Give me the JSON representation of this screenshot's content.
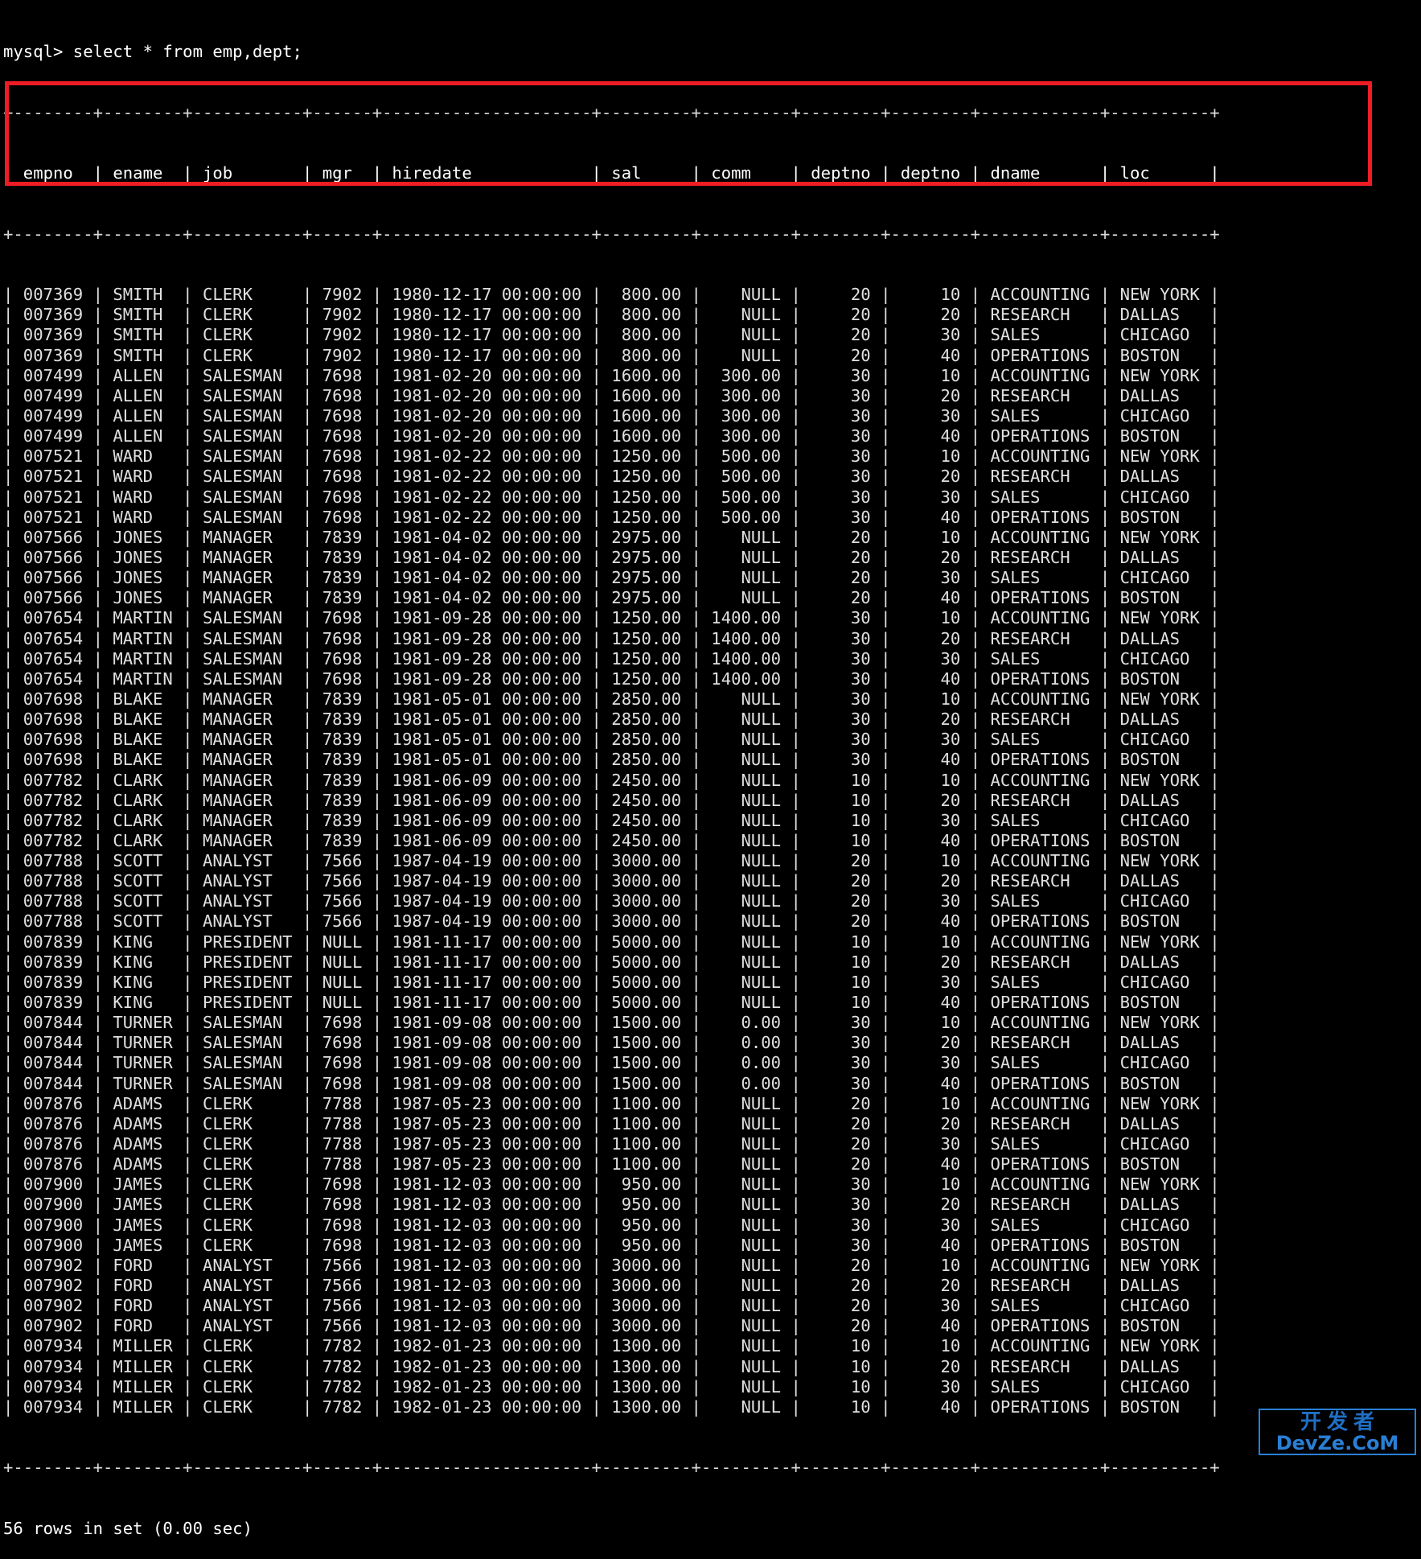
{
  "terminal": {
    "prompt": "mysql> ",
    "query": "select * from emp,dept;",
    "prompt_line": "mysql> select * from emp,dept;",
    "status": "56 rows in set (0.00 sec)",
    "row_count": 56,
    "elapsed": "0.00 sec",
    "background_color": "#000000",
    "text_color": "#e8e8e8"
  },
  "highlight": {
    "color": "#ee1c25",
    "target_rows": 4,
    "target_empno": "007369",
    "target_ename": "SMITH",
    "note": "red box around the four SMITH rows"
  },
  "watermark": {
    "cn": "开发者",
    "en": "DevZe.CoM",
    "color": "#2a7fd4"
  },
  "table": {
    "separator": "+--------+--------+-----------+------+---------------------+---------+---------+--------+--------+------------+----------+",
    "columns": [
      {
        "name": "empno",
        "width": 6,
        "align": "right"
      },
      {
        "name": "ename",
        "width": 6,
        "align": "left"
      },
      {
        "name": "job",
        "width": 9,
        "align": "left"
      },
      {
        "name": "mgr",
        "width": 4,
        "align": "right"
      },
      {
        "name": "hiredate",
        "width": 19,
        "align": "left"
      },
      {
        "name": "sal",
        "width": 7,
        "align": "right"
      },
      {
        "name": "comm",
        "width": 7,
        "align": "right"
      },
      {
        "name": "deptno",
        "width": 6,
        "align": "right"
      },
      {
        "name": "deptno",
        "width": 6,
        "align": "right"
      },
      {
        "name": "dname",
        "width": 10,
        "align": "left"
      },
      {
        "name": "loc",
        "width": 8,
        "align": "left"
      }
    ],
    "headers": [
      "empno",
      "ename",
      "job",
      "mgr",
      "hiredate",
      "sal",
      "comm",
      "deptno",
      "deptno",
      "dname",
      "loc"
    ],
    "rows": [
      [
        "007369",
        "SMITH",
        "CLERK",
        "7902",
        "1980-12-17 00:00:00",
        "800.00",
        "NULL",
        "20",
        "10",
        "ACCOUNTING",
        "NEW YORK"
      ],
      [
        "007369",
        "SMITH",
        "CLERK",
        "7902",
        "1980-12-17 00:00:00",
        "800.00",
        "NULL",
        "20",
        "20",
        "RESEARCH",
        "DALLAS"
      ],
      [
        "007369",
        "SMITH",
        "CLERK",
        "7902",
        "1980-12-17 00:00:00",
        "800.00",
        "NULL",
        "20",
        "30",
        "SALES",
        "CHICAGO"
      ],
      [
        "007369",
        "SMITH",
        "CLERK",
        "7902",
        "1980-12-17 00:00:00",
        "800.00",
        "NULL",
        "20",
        "40",
        "OPERATIONS",
        "BOSTON"
      ],
      [
        "007499",
        "ALLEN",
        "SALESMAN",
        "7698",
        "1981-02-20 00:00:00",
        "1600.00",
        "300.00",
        "30",
        "10",
        "ACCOUNTING",
        "NEW YORK"
      ],
      [
        "007499",
        "ALLEN",
        "SALESMAN",
        "7698",
        "1981-02-20 00:00:00",
        "1600.00",
        "300.00",
        "30",
        "20",
        "RESEARCH",
        "DALLAS"
      ],
      [
        "007499",
        "ALLEN",
        "SALESMAN",
        "7698",
        "1981-02-20 00:00:00",
        "1600.00",
        "300.00",
        "30",
        "30",
        "SALES",
        "CHICAGO"
      ],
      [
        "007499",
        "ALLEN",
        "SALESMAN",
        "7698",
        "1981-02-20 00:00:00",
        "1600.00",
        "300.00",
        "30",
        "40",
        "OPERATIONS",
        "BOSTON"
      ],
      [
        "007521",
        "WARD",
        "SALESMAN",
        "7698",
        "1981-02-22 00:00:00",
        "1250.00",
        "500.00",
        "30",
        "10",
        "ACCOUNTING",
        "NEW YORK"
      ],
      [
        "007521",
        "WARD",
        "SALESMAN",
        "7698",
        "1981-02-22 00:00:00",
        "1250.00",
        "500.00",
        "30",
        "20",
        "RESEARCH",
        "DALLAS"
      ],
      [
        "007521",
        "WARD",
        "SALESMAN",
        "7698",
        "1981-02-22 00:00:00",
        "1250.00",
        "500.00",
        "30",
        "30",
        "SALES",
        "CHICAGO"
      ],
      [
        "007521",
        "WARD",
        "SALESMAN",
        "7698",
        "1981-02-22 00:00:00",
        "1250.00",
        "500.00",
        "30",
        "40",
        "OPERATIONS",
        "BOSTON"
      ],
      [
        "007566",
        "JONES",
        "MANAGER",
        "7839",
        "1981-04-02 00:00:00",
        "2975.00",
        "NULL",
        "20",
        "10",
        "ACCOUNTING",
        "NEW YORK"
      ],
      [
        "007566",
        "JONES",
        "MANAGER",
        "7839",
        "1981-04-02 00:00:00",
        "2975.00",
        "NULL",
        "20",
        "20",
        "RESEARCH",
        "DALLAS"
      ],
      [
        "007566",
        "JONES",
        "MANAGER",
        "7839",
        "1981-04-02 00:00:00",
        "2975.00",
        "NULL",
        "20",
        "30",
        "SALES",
        "CHICAGO"
      ],
      [
        "007566",
        "JONES",
        "MANAGER",
        "7839",
        "1981-04-02 00:00:00",
        "2975.00",
        "NULL",
        "20",
        "40",
        "OPERATIONS",
        "BOSTON"
      ],
      [
        "007654",
        "MARTIN",
        "SALESMAN",
        "7698",
        "1981-09-28 00:00:00",
        "1250.00",
        "1400.00",
        "30",
        "10",
        "ACCOUNTING",
        "NEW YORK"
      ],
      [
        "007654",
        "MARTIN",
        "SALESMAN",
        "7698",
        "1981-09-28 00:00:00",
        "1250.00",
        "1400.00",
        "30",
        "20",
        "RESEARCH",
        "DALLAS"
      ],
      [
        "007654",
        "MARTIN",
        "SALESMAN",
        "7698",
        "1981-09-28 00:00:00",
        "1250.00",
        "1400.00",
        "30",
        "30",
        "SALES",
        "CHICAGO"
      ],
      [
        "007654",
        "MARTIN",
        "SALESMAN",
        "7698",
        "1981-09-28 00:00:00",
        "1250.00",
        "1400.00",
        "30",
        "40",
        "OPERATIONS",
        "BOSTON"
      ],
      [
        "007698",
        "BLAKE",
        "MANAGER",
        "7839",
        "1981-05-01 00:00:00",
        "2850.00",
        "NULL",
        "30",
        "10",
        "ACCOUNTING",
        "NEW YORK"
      ],
      [
        "007698",
        "BLAKE",
        "MANAGER",
        "7839",
        "1981-05-01 00:00:00",
        "2850.00",
        "NULL",
        "30",
        "20",
        "RESEARCH",
        "DALLAS"
      ],
      [
        "007698",
        "BLAKE",
        "MANAGER",
        "7839",
        "1981-05-01 00:00:00",
        "2850.00",
        "NULL",
        "30",
        "30",
        "SALES",
        "CHICAGO"
      ],
      [
        "007698",
        "BLAKE",
        "MANAGER",
        "7839",
        "1981-05-01 00:00:00",
        "2850.00",
        "NULL",
        "30",
        "40",
        "OPERATIONS",
        "BOSTON"
      ],
      [
        "007782",
        "CLARK",
        "MANAGER",
        "7839",
        "1981-06-09 00:00:00",
        "2450.00",
        "NULL",
        "10",
        "10",
        "ACCOUNTING",
        "NEW YORK"
      ],
      [
        "007782",
        "CLARK",
        "MANAGER",
        "7839",
        "1981-06-09 00:00:00",
        "2450.00",
        "NULL",
        "10",
        "20",
        "RESEARCH",
        "DALLAS"
      ],
      [
        "007782",
        "CLARK",
        "MANAGER",
        "7839",
        "1981-06-09 00:00:00",
        "2450.00",
        "NULL",
        "10",
        "30",
        "SALES",
        "CHICAGO"
      ],
      [
        "007782",
        "CLARK",
        "MANAGER",
        "7839",
        "1981-06-09 00:00:00",
        "2450.00",
        "NULL",
        "10",
        "40",
        "OPERATIONS",
        "BOSTON"
      ],
      [
        "007788",
        "SCOTT",
        "ANALYST",
        "7566",
        "1987-04-19 00:00:00",
        "3000.00",
        "NULL",
        "20",
        "10",
        "ACCOUNTING",
        "NEW YORK"
      ],
      [
        "007788",
        "SCOTT",
        "ANALYST",
        "7566",
        "1987-04-19 00:00:00",
        "3000.00",
        "NULL",
        "20",
        "20",
        "RESEARCH",
        "DALLAS"
      ],
      [
        "007788",
        "SCOTT",
        "ANALYST",
        "7566",
        "1987-04-19 00:00:00",
        "3000.00",
        "NULL",
        "20",
        "30",
        "SALES",
        "CHICAGO"
      ],
      [
        "007788",
        "SCOTT",
        "ANALYST",
        "7566",
        "1987-04-19 00:00:00",
        "3000.00",
        "NULL",
        "20",
        "40",
        "OPERATIONS",
        "BOSTON"
      ],
      [
        "007839",
        "KING",
        "PRESIDENT",
        "NULL",
        "1981-11-17 00:00:00",
        "5000.00",
        "NULL",
        "10",
        "10",
        "ACCOUNTING",
        "NEW YORK"
      ],
      [
        "007839",
        "KING",
        "PRESIDENT",
        "NULL",
        "1981-11-17 00:00:00",
        "5000.00",
        "NULL",
        "10",
        "20",
        "RESEARCH",
        "DALLAS"
      ],
      [
        "007839",
        "KING",
        "PRESIDENT",
        "NULL",
        "1981-11-17 00:00:00",
        "5000.00",
        "NULL",
        "10",
        "30",
        "SALES",
        "CHICAGO"
      ],
      [
        "007839",
        "KING",
        "PRESIDENT",
        "NULL",
        "1981-11-17 00:00:00",
        "5000.00",
        "NULL",
        "10",
        "40",
        "OPERATIONS",
        "BOSTON"
      ],
      [
        "007844",
        "TURNER",
        "SALESMAN",
        "7698",
        "1981-09-08 00:00:00",
        "1500.00",
        "0.00",
        "30",
        "10",
        "ACCOUNTING",
        "NEW YORK"
      ],
      [
        "007844",
        "TURNER",
        "SALESMAN",
        "7698",
        "1981-09-08 00:00:00",
        "1500.00",
        "0.00",
        "30",
        "20",
        "RESEARCH",
        "DALLAS"
      ],
      [
        "007844",
        "TURNER",
        "SALESMAN",
        "7698",
        "1981-09-08 00:00:00",
        "1500.00",
        "0.00",
        "30",
        "30",
        "SALES",
        "CHICAGO"
      ],
      [
        "007844",
        "TURNER",
        "SALESMAN",
        "7698",
        "1981-09-08 00:00:00",
        "1500.00",
        "0.00",
        "30",
        "40",
        "OPERATIONS",
        "BOSTON"
      ],
      [
        "007876",
        "ADAMS",
        "CLERK",
        "7788",
        "1987-05-23 00:00:00",
        "1100.00",
        "NULL",
        "20",
        "10",
        "ACCOUNTING",
        "NEW YORK"
      ],
      [
        "007876",
        "ADAMS",
        "CLERK",
        "7788",
        "1987-05-23 00:00:00",
        "1100.00",
        "NULL",
        "20",
        "20",
        "RESEARCH",
        "DALLAS"
      ],
      [
        "007876",
        "ADAMS",
        "CLERK",
        "7788",
        "1987-05-23 00:00:00",
        "1100.00",
        "NULL",
        "20",
        "30",
        "SALES",
        "CHICAGO"
      ],
      [
        "007876",
        "ADAMS",
        "CLERK",
        "7788",
        "1987-05-23 00:00:00",
        "1100.00",
        "NULL",
        "20",
        "40",
        "OPERATIONS",
        "BOSTON"
      ],
      [
        "007900",
        "JAMES",
        "CLERK",
        "7698",
        "1981-12-03 00:00:00",
        "950.00",
        "NULL",
        "30",
        "10",
        "ACCOUNTING",
        "NEW YORK"
      ],
      [
        "007900",
        "JAMES",
        "CLERK",
        "7698",
        "1981-12-03 00:00:00",
        "950.00",
        "NULL",
        "30",
        "20",
        "RESEARCH",
        "DALLAS"
      ],
      [
        "007900",
        "JAMES",
        "CLERK",
        "7698",
        "1981-12-03 00:00:00",
        "950.00",
        "NULL",
        "30",
        "30",
        "SALES",
        "CHICAGO"
      ],
      [
        "007900",
        "JAMES",
        "CLERK",
        "7698",
        "1981-12-03 00:00:00",
        "950.00",
        "NULL",
        "30",
        "40",
        "OPERATIONS",
        "BOSTON"
      ],
      [
        "007902",
        "FORD",
        "ANALYST",
        "7566",
        "1981-12-03 00:00:00",
        "3000.00",
        "NULL",
        "20",
        "10",
        "ACCOUNTING",
        "NEW YORK"
      ],
      [
        "007902",
        "FORD",
        "ANALYST",
        "7566",
        "1981-12-03 00:00:00",
        "3000.00",
        "NULL",
        "20",
        "20",
        "RESEARCH",
        "DALLAS"
      ],
      [
        "007902",
        "FORD",
        "ANALYST",
        "7566",
        "1981-12-03 00:00:00",
        "3000.00",
        "NULL",
        "20",
        "30",
        "SALES",
        "CHICAGO"
      ],
      [
        "007902",
        "FORD",
        "ANALYST",
        "7566",
        "1981-12-03 00:00:00",
        "3000.00",
        "NULL",
        "20",
        "40",
        "OPERATIONS",
        "BOSTON"
      ],
      [
        "007934",
        "MILLER",
        "CLERK",
        "7782",
        "1982-01-23 00:00:00",
        "1300.00",
        "NULL",
        "10",
        "10",
        "ACCOUNTING",
        "NEW YORK"
      ],
      [
        "007934",
        "MILLER",
        "CLERK",
        "7782",
        "1982-01-23 00:00:00",
        "1300.00",
        "NULL",
        "10",
        "20",
        "RESEARCH",
        "DALLAS"
      ],
      [
        "007934",
        "MILLER",
        "CLERK",
        "7782",
        "1982-01-23 00:00:00",
        "1300.00",
        "NULL",
        "10",
        "30",
        "SALES",
        "CHICAGO"
      ],
      [
        "007934",
        "MILLER",
        "CLERK",
        "7782",
        "1982-01-23 00:00:00",
        "1300.00",
        "NULL",
        "10",
        "40",
        "OPERATIONS",
        "BOSTON"
      ]
    ]
  }
}
